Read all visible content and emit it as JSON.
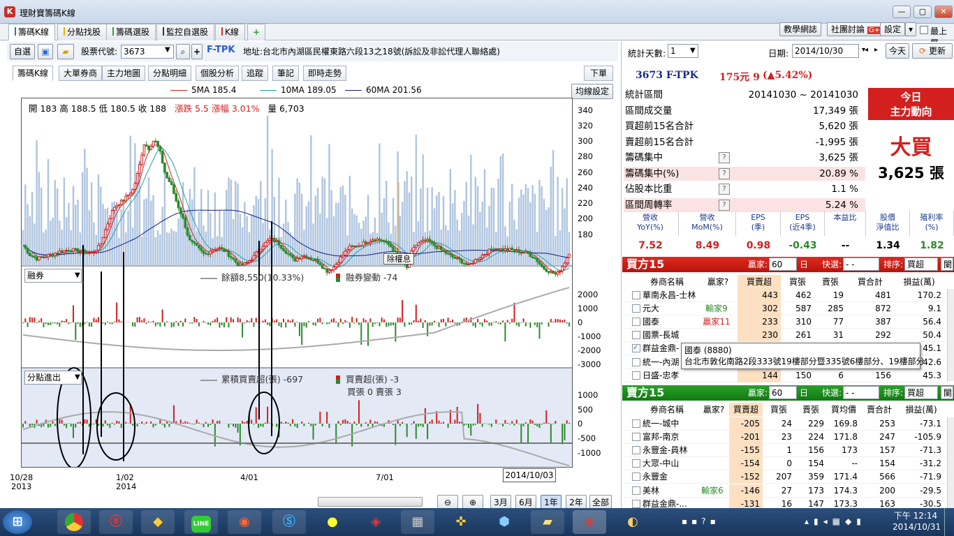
{
  "window": {
    "title": "理財寶籌碼K線",
    "app_icon": "K",
    "btn_min": "—",
    "btn_max": "▢",
    "btn_close": "✕"
  },
  "main_tabs": [
    {
      "label": "籌碼K線",
      "color": "#2a6fd1"
    },
    {
      "label": "分點找股",
      "color": "#e6b400"
    },
    {
      "label": "籌碼選股",
      "color": "#3a9a3a"
    },
    {
      "label": "監控自選股",
      "color": "#333333"
    },
    {
      "label": "K線",
      "color": "#d03030"
    }
  ],
  "top_buttons": {
    "teaching": "教學網誌",
    "forum": "社團討論",
    "forum_badge": "G+",
    "settings": "設定",
    "topmost": "最上層"
  },
  "toolbar": {
    "watchlist": "自選",
    "stock_code_label": "股票代號:",
    "stock_code": "3673",
    "stock_name": "F-TPK",
    "address": "地址:台北市內湖區民權東路六段13之18號(訴訟及非訟代理人聯絡處)"
  },
  "sub_tabs": [
    "籌碼K線",
    "大單券商",
    "主力地圖",
    "分點明細",
    "個股分析",
    "追蹤",
    "筆記",
    "即時走勢"
  ],
  "menu_button": "下單",
  "ma_settings": "均線設定",
  "ma_legend": [
    {
      "label": "5MA 185.4",
      "color": "#d02020"
    },
    {
      "label": "10MA 189.05",
      "color": "#20a0a0"
    },
    {
      "label": "60MA 201.56",
      "color": "#1a1a80"
    }
  ],
  "ohlc": {
    "text": "開 183  高 188.5  低 180.5  收 188",
    "change": "漲跌 5.5  漲幅  3.01%",
    "volume": "量 6,703"
  },
  "ex_dividend_label": "除權息",
  "panel2": {
    "select": "融券",
    "legend1": "餘額8,550(10.33%)",
    "legend2": "融券變動 -74"
  },
  "panel3": {
    "select": "分點進出",
    "legend1": "累積買賣超(張) -697",
    "legend2": "買賣超(張) -3",
    "legend3": "買張 0  賣張 3"
  },
  "y_price": [
    "340",
    "320",
    "300",
    "280",
    "260",
    "240",
    "220",
    "200",
    "180"
  ],
  "y_margin": [
    "2000",
    "1000",
    "0",
    "-1000",
    "-2000",
    "-3000"
  ],
  "y_broker": [
    "1000",
    "500",
    "0",
    "-500",
    "-1000"
  ],
  "x_labels": [
    {
      "top": "10/28",
      "bottom": "2013"
    },
    {
      "top": "1/02",
      "bottom": "2014"
    },
    {
      "top": "4/01",
      "bottom": ""
    },
    {
      "top": "7/01",
      "bottom": ""
    }
  ],
  "cursor_date": "2014/10/03",
  "range_buttons": [
    "3月",
    "6月",
    "1年",
    "2年",
    "全部"
  ],
  "active_range": "1年",
  "right_panel": {
    "stat_days_label": "統計天數:",
    "stat_days": "1",
    "date_label": "日期:",
    "date": "2014/10/30",
    "today_btn": "今天",
    "refresh_btn": "更新",
    "stock_line": "3673 F-TPK",
    "price": "175元 9",
    "change": "(▲5.42%)",
    "rows": [
      {
        "label": "統計區間",
        "value": "20141030 ~ 20141030",
        "q": false,
        "hl": false
      },
      {
        "label": "區間成交量",
        "value": "17,349 張",
        "q": false,
        "hl": false
      },
      {
        "label": "買超前15名合計",
        "value": "5,620 張",
        "q": false,
        "hl": false
      },
      {
        "label": "賣超前15名合計",
        "value": "-1,995 張",
        "q": false,
        "hl": false
      },
      {
        "label": "籌碼集中",
        "value": "3,625 張",
        "q": true,
        "hl": false
      },
      {
        "label": "籌碼集中(%)",
        "value": "20.89 %",
        "q": true,
        "hl": true
      },
      {
        "label": "佔股本比重",
        "value": "1.1 %",
        "q": true,
        "hl": false
      },
      {
        "label": "區間周轉率",
        "value": "5.24 %",
        "q": true,
        "hl": true
      }
    ],
    "main_force_title": "今日\n主力動向",
    "main_force_title_1": "今日",
    "main_force_title_2": "主力動向",
    "main_force_state": "大買",
    "main_force_value": "3,625 張",
    "kpis": [
      {
        "h1": "營收",
        "h2": "YoY(%)",
        "v": "7.52",
        "c": "#d02020"
      },
      {
        "h1": "營收",
        "h2": "MoM(%)",
        "v": "8.49",
        "c": "#d02020"
      },
      {
        "h1": "EPS",
        "h2": "(季)",
        "v": "0.98",
        "c": "#d02020"
      },
      {
        "h1": "EPS",
        "h2": "(近4季)",
        "v": "-0.43",
        "c": "#2a8a2a"
      },
      {
        "h1": "本益比",
        "h2": "",
        "v": "--",
        "c": "#000000"
      },
      {
        "h1": "股價",
        "h2": "淨值比",
        "v": "1.34",
        "c": "#000000"
      },
      {
        "h1": "殖利率",
        "h2": "(%)",
        "v": "1.82",
        "c": "#2a8a2a"
      }
    ]
  },
  "buy_section": {
    "title": "買方15",
    "winner_label": "贏家:",
    "winner_val": "60",
    "day": "日",
    "filter_label": "快選:",
    "filter_val": "- -",
    "sort_label": "排序:",
    "sort_val": "買超",
    "more": "闌",
    "columns": [
      "券商名稱",
      "贏家?",
      "買賣超",
      "買張",
      "賣張",
      "買合計",
      "損益(萬)"
    ],
    "rows": [
      {
        "name": "華南永昌-士林",
        "tag": "",
        "tagc": "",
        "net": "443",
        "buy": "462",
        "sell": "19",
        "total": "481",
        "pl": "170.2",
        "checked": false
      },
      {
        "name": "元大",
        "tag": "輸家9",
        "tagc": "#2a8a2a",
        "net": "302",
        "buy": "587",
        "sell": "285",
        "total": "872",
        "pl": "9.1",
        "checked": false
      },
      {
        "name": "國泰",
        "tag": "贏家11",
        "tagc": "#d02020",
        "net": "233",
        "buy": "310",
        "sell": "77",
        "total": "387",
        "pl": "56.4",
        "checked": false
      },
      {
        "name": "國票-長城",
        "tag": "",
        "tagc": "",
        "net": "230",
        "buy": "261",
        "sell": "31",
        "total": "292",
        "pl": "50.4",
        "checked": false
      },
      {
        "name": "群益金鼎-",
        "tag": "",
        "tagc": "",
        "net": "",
        "buy": "",
        "sell": "",
        "total": "",
        "pl": "45.1",
        "checked": true
      },
      {
        "name": "統一-內湖",
        "tag": "",
        "tagc": "",
        "net": "",
        "buy": "",
        "sell": "",
        "total": "",
        "pl": "42.6",
        "checked": false
      },
      {
        "name": "日盛-忠孝",
        "tag": "",
        "tagc": "",
        "net": "144",
        "buy": "150",
        "sell": "6",
        "total": "156",
        "pl": "45.3",
        "checked": false
      }
    ],
    "tooltip_1": "國泰 (8880)",
    "tooltip_2": "台北市敦化南路2段333號19樓部分暨335號6樓部分、19樓部分"
  },
  "sell_section": {
    "title": "賣方15",
    "winner_label": "贏家:",
    "winner_val": "60",
    "day": "日",
    "filter_label": "快選:",
    "filter_val": "- -",
    "sort_label": "排序:",
    "sort_val": "買超",
    "more": "闌",
    "columns": [
      "券商名稱",
      "贏家?",
      "買賣超",
      "買張",
      "賣張",
      "買均價",
      "賣合計",
      "損益(萬)"
    ],
    "rows": [
      {
        "name": "統一-城中",
        "tag": "",
        "tagc": "",
        "net": "-205",
        "buy": "24",
        "sell": "229",
        "avg": "169.8",
        "total": "253",
        "pl": "-73.1"
      },
      {
        "name": "富邦-南京",
        "tag": "",
        "tagc": "",
        "net": "-201",
        "buy": "23",
        "sell": "224",
        "avg": "171.8",
        "total": "247",
        "pl": "-105.9"
      },
      {
        "name": "永豐金-員林",
        "tag": "",
        "tagc": "",
        "net": "-155",
        "buy": "1",
        "sell": "156",
        "avg": "173",
        "total": "157",
        "pl": "-71.3"
      },
      {
        "name": "大眾-中山",
        "tag": "",
        "tagc": "",
        "net": "-154",
        "buy": "0",
        "sell": "154",
        "avg": "--",
        "total": "154",
        "pl": "-31.2"
      },
      {
        "name": "永豐金",
        "tag": "",
        "tagc": "",
        "net": "-152",
        "buy": "207",
        "sell": "359",
        "avg": "171.4",
        "total": "566",
        "pl": "-71.9"
      },
      {
        "name": "美林",
        "tag": "輸家6",
        "tagc": "#2a8a2a",
        "net": "-146",
        "buy": "27",
        "sell": "173",
        "avg": "174.3",
        "total": "200",
        "pl": "-29.5"
      },
      {
        "name": "群益金鼎-...",
        "tag": "",
        "tagc": "",
        "net": "-131",
        "buy": "16",
        "sell": "147",
        "avg": "173.3",
        "total": "163",
        "pl": "-30.5"
      }
    ]
  },
  "taskbar": {
    "time": "下午 12:14",
    "date": "2014/10/31"
  }
}
